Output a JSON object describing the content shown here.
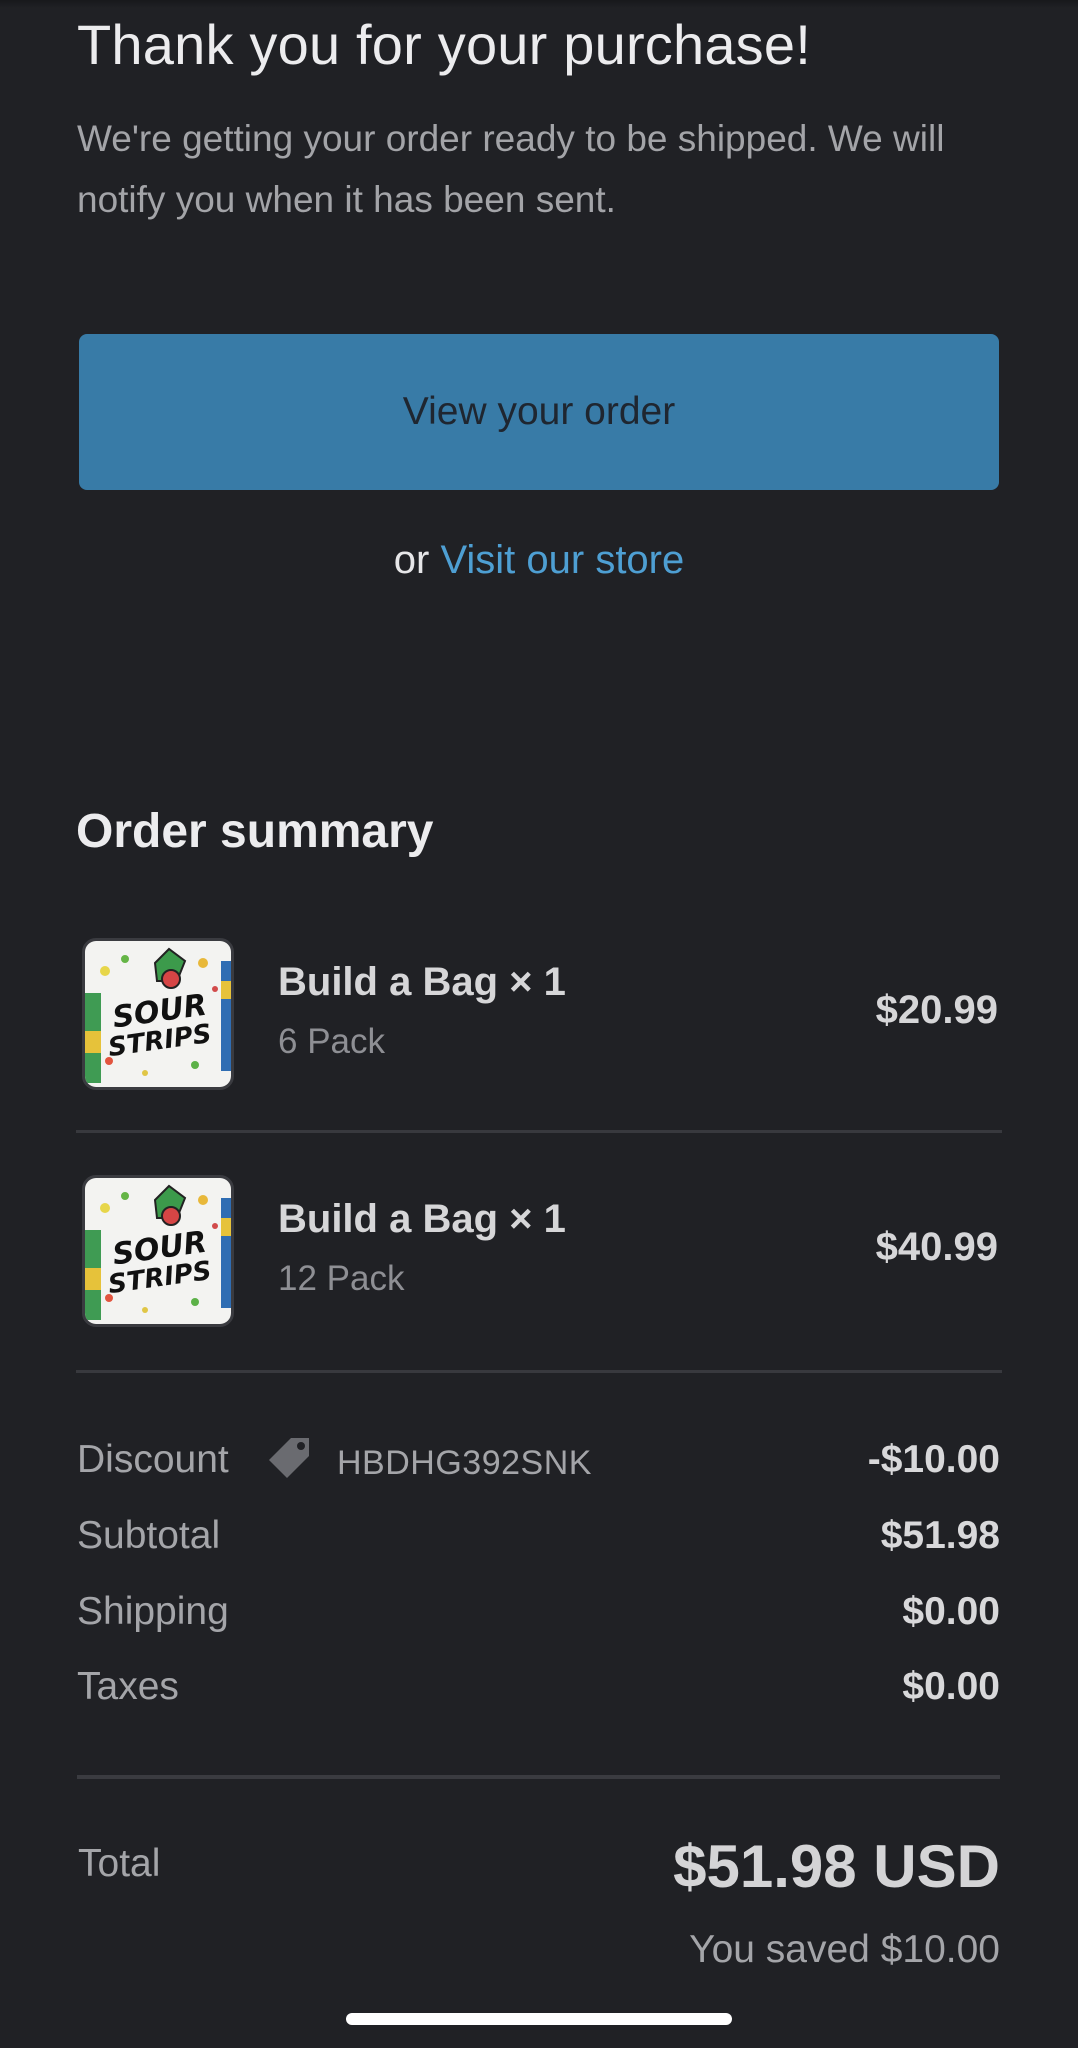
{
  "header": {
    "title": "Thank you for your purchase!",
    "subtitle": "We're getting your order ready to be shipped. We will notify you when it has been sent."
  },
  "actions": {
    "view_order_label": "View your order",
    "or_text": "or",
    "visit_store_label": "Visit our store"
  },
  "summary": {
    "title": "Order summary",
    "items": [
      {
        "name": "Build a Bag × 1",
        "variant": "6 Pack",
        "price": "$20.99",
        "image_text": "SOUR STRIPS"
      },
      {
        "name": "Build a Bag × 1",
        "variant": "12 Pack",
        "price": "$40.99",
        "image_text": "SOUR STRIPS"
      }
    ],
    "discount": {
      "label": "Discount",
      "icon": "price-tag-icon",
      "code": "HBDHG392SNK",
      "value": "-$10.00"
    },
    "subtotal": {
      "label": "Subtotal",
      "value": "$51.98"
    },
    "shipping": {
      "label": "Shipping",
      "value": "$0.00"
    },
    "taxes": {
      "label": "Taxes",
      "value": "$0.00"
    },
    "total": {
      "label": "Total",
      "value": "$51.98 USD"
    },
    "saved": "You saved $10.00"
  },
  "colors": {
    "background": "#202125",
    "button": "#387ba7",
    "link": "#4e9fd3"
  }
}
